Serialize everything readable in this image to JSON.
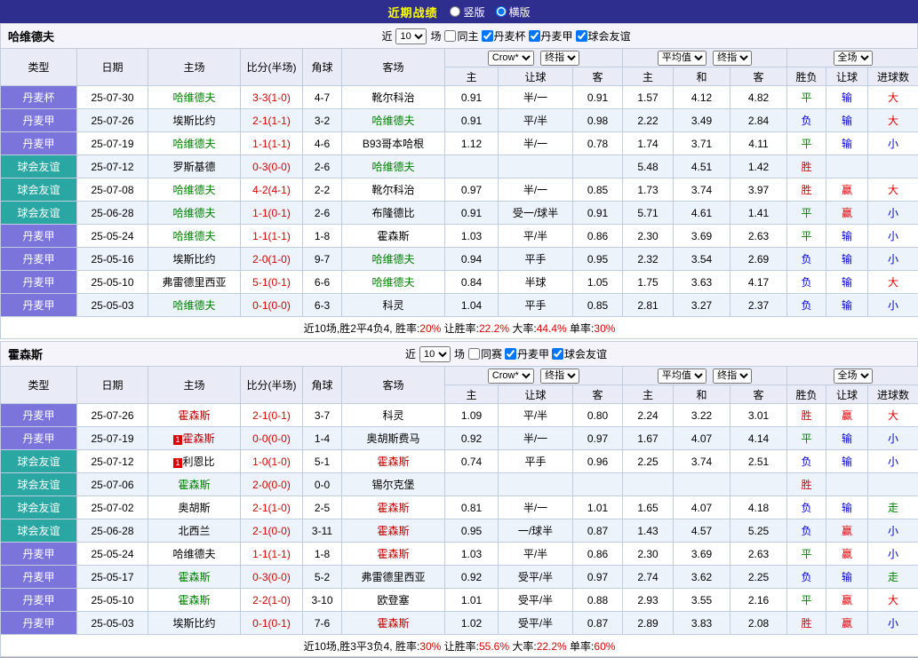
{
  "titlebar": {
    "title": "近期战绩",
    "view_options": [
      {
        "label": "竖版",
        "selected": false
      },
      {
        "label": "横版",
        "selected": true
      }
    ]
  },
  "colors": {
    "topbar_bg": "#2e2e8f",
    "title_text": "#ffff00",
    "cup_bg": "#7b74da",
    "league_bg": "#7b74da",
    "friendly_bg": "#2aa7a2",
    "win_red": "#e10000",
    "draw_green": "#008000",
    "lose_blue": "#0000d9",
    "focus_team_green": "#008000",
    "focus_team_red": "#c00000",
    "score_red": "#d60000"
  },
  "sections": [
    {
      "team": "哈维德夫",
      "filter": {
        "prefix": "近",
        "count": "10",
        "suffix": "场",
        "checkboxes": [
          {
            "label": "同主",
            "checked": false
          },
          {
            "label": "丹麦杯",
            "checked": true
          },
          {
            "label": "丹麦甲",
            "checked": true
          },
          {
            "label": "球会友谊",
            "checked": true
          }
        ]
      },
      "columns": {
        "type": "类型",
        "date": "日期",
        "home": "主场",
        "score": "比分(半场)",
        "corner": "角球",
        "away": "客场",
        "odds_group": {
          "select1": "Crow*",
          "select2": "终指",
          "subs": [
            "主",
            "让球",
            "客"
          ]
        },
        "avg_group": {
          "select1": "平均值",
          "select2": "终指",
          "subs": [
            "主",
            "和",
            "客"
          ]
        },
        "result_group": {
          "select1": "全场",
          "subs": [
            "胜负",
            "让球",
            "进球数"
          ]
        }
      },
      "rows": [
        {
          "type": "丹麦杯",
          "type_cls": "t-cup",
          "date": "25-07-30",
          "home": "哈维德夫",
          "home_cls": "n-green",
          "score": "3-3(1-0)",
          "corner": "4-7",
          "away": "靴尔科治",
          "away_cls": "",
          "odds": [
            "0.91",
            "半/一",
            "0.91"
          ],
          "avg": [
            "1.57",
            "4.12",
            "4.82"
          ],
          "res": [
            {
              "t": "平",
              "c": "g"
            },
            {
              "t": "输",
              "c": "b"
            },
            {
              "t": "大",
              "c": "r"
            }
          ]
        },
        {
          "type": "丹麦甲",
          "type_cls": "t-league",
          "date": "25-07-26",
          "home": "埃斯比约",
          "home_cls": "",
          "score": "2-1(1-1)",
          "corner": "3-2",
          "away": "哈维德夫",
          "away_cls": "n-green",
          "odds": [
            "0.91",
            "平/半",
            "0.98"
          ],
          "avg": [
            "2.22",
            "3.49",
            "2.84"
          ],
          "res": [
            {
              "t": "负",
              "c": "b"
            },
            {
              "t": "输",
              "c": "b"
            },
            {
              "t": "大",
              "c": "r"
            }
          ]
        },
        {
          "type": "丹麦甲",
          "type_cls": "t-league",
          "date": "25-07-19",
          "home": "哈维德夫",
          "home_cls": "n-green",
          "score": "1-1(1-1)",
          "corner": "4-6",
          "away": "B93哥本哈根",
          "away_cls": "",
          "odds": [
            "1.12",
            "半/一",
            "0.78"
          ],
          "avg": [
            "1.74",
            "3.71",
            "4.11"
          ],
          "res": [
            {
              "t": "平",
              "c": "g"
            },
            {
              "t": "输",
              "c": "b"
            },
            {
              "t": "小",
              "c": "b"
            }
          ]
        },
        {
          "type": "球会友谊",
          "type_cls": "t-friendly",
          "date": "25-07-12",
          "home": "罗斯基德",
          "home_cls": "",
          "score": "0-3(0-0)",
          "corner": "2-6",
          "away": "哈维德夫",
          "away_cls": "n-green",
          "odds": [
            "",
            "",
            ""
          ],
          "avg": [
            "5.48",
            "4.51",
            "1.42"
          ],
          "res": [
            {
              "t": "胜",
              "c": "r"
            },
            {
              "t": "",
              "c": "b"
            },
            {
              "t": "",
              "c": "b"
            }
          ]
        },
        {
          "type": "球会友谊",
          "type_cls": "t-friendly",
          "date": "25-07-08",
          "home": "哈维德夫",
          "home_cls": "n-green",
          "score": "4-2(4-1)",
          "corner": "2-2",
          "away": "靴尔科治",
          "away_cls": "",
          "odds": [
            "0.97",
            "半/一",
            "0.85"
          ],
          "avg": [
            "1.73",
            "3.74",
            "3.97"
          ],
          "res": [
            {
              "t": "胜",
              "c": "r"
            },
            {
              "t": "赢",
              "c": "r"
            },
            {
              "t": "大",
              "c": "r"
            }
          ]
        },
        {
          "type": "球会友谊",
          "type_cls": "t-friendly",
          "date": "25-06-28",
          "home": "哈维德夫",
          "home_cls": "n-green",
          "score": "1-1(0-1)",
          "corner": "2-6",
          "away": "布隆德比",
          "away_cls": "",
          "odds": [
            "0.91",
            "受一/球半",
            "0.91"
          ],
          "avg": [
            "5.71",
            "4.61",
            "1.41"
          ],
          "res": [
            {
              "t": "平",
              "c": "g"
            },
            {
              "t": "赢",
              "c": "r"
            },
            {
              "t": "小",
              "c": "b"
            }
          ]
        },
        {
          "type": "丹麦甲",
          "type_cls": "t-league",
          "date": "25-05-24",
          "home": "哈维德夫",
          "home_cls": "n-green",
          "score": "1-1(1-1)",
          "corner": "1-8",
          "away": "霍森斯",
          "away_cls": "",
          "odds": [
            "1.03",
            "平/半",
            "0.86"
          ],
          "avg": [
            "2.30",
            "3.69",
            "2.63"
          ],
          "res": [
            {
              "t": "平",
              "c": "g"
            },
            {
              "t": "输",
              "c": "b"
            },
            {
              "t": "小",
              "c": "b"
            }
          ]
        },
        {
          "type": "丹麦甲",
          "type_cls": "t-league",
          "date": "25-05-16",
          "home": "埃斯比约",
          "home_cls": "",
          "score": "2-0(1-0)",
          "corner": "9-7",
          "away": "哈维德夫",
          "away_cls": "n-green",
          "odds": [
            "0.94",
            "平手",
            "0.95"
          ],
          "avg": [
            "2.32",
            "3.54",
            "2.69"
          ],
          "res": [
            {
              "t": "负",
              "c": "b"
            },
            {
              "t": "输",
              "c": "b"
            },
            {
              "t": "小",
              "c": "b"
            }
          ]
        },
        {
          "type": "丹麦甲",
          "type_cls": "t-league",
          "date": "25-05-10",
          "home": "弗雷德里西亚",
          "home_cls": "",
          "score": "5-1(0-1)",
          "corner": "6-6",
          "away": "哈维德夫",
          "away_cls": "n-green",
          "odds": [
            "0.84",
            "半球",
            "1.05"
          ],
          "avg": [
            "1.75",
            "3.63",
            "4.17"
          ],
          "res": [
            {
              "t": "负",
              "c": "b"
            },
            {
              "t": "输",
              "c": "b"
            },
            {
              "t": "大",
              "c": "r"
            }
          ]
        },
        {
          "type": "丹麦甲",
          "type_cls": "t-league",
          "date": "25-05-03",
          "home": "哈维德夫",
          "home_cls": "n-green",
          "score": "0-1(0-0)",
          "corner": "6-3",
          "away": "科灵",
          "away_cls": "",
          "odds": [
            "1.04",
            "平手",
            "0.85"
          ],
          "avg": [
            "2.81",
            "3.27",
            "2.37"
          ],
          "res": [
            {
              "t": "负",
              "c": "b"
            },
            {
              "t": "输",
              "c": "b"
            },
            {
              "t": "小",
              "c": "b"
            }
          ]
        }
      ],
      "summary": {
        "prefix": "近10场,胜2平4负4,",
        "stats": [
          {
            "label": "胜率:",
            "value": "20%"
          },
          {
            "label": "让胜率:",
            "value": "22.2%"
          },
          {
            "label": "大率:",
            "value": "44.4%"
          },
          {
            "label": "单率:",
            "value": "30%"
          }
        ]
      }
    },
    {
      "team": "霍森斯",
      "filter": {
        "prefix": "近",
        "count": "10",
        "suffix": "场",
        "checkboxes": [
          {
            "label": "同赛",
            "checked": false
          },
          {
            "label": "丹麦甲",
            "checked": true
          },
          {
            "label": "球会友谊",
            "checked": true
          }
        ]
      },
      "columns": {
        "type": "类型",
        "date": "日期",
        "home": "主场",
        "score": "比分(半场)",
        "corner": "角球",
        "away": "客场",
        "odds_group": {
          "select1": "Crow*",
          "select2": "终指",
          "subs": [
            "主",
            "让球",
            "客"
          ]
        },
        "avg_group": {
          "select1": "平均值",
          "select2": "终指",
          "subs": [
            "主",
            "和",
            "客"
          ]
        },
        "result_group": {
          "select1": "全场",
          "subs": [
            "胜负",
            "让球",
            "进球数"
          ]
        }
      },
      "rows": [
        {
          "type": "丹麦甲",
          "type_cls": "t-league",
          "date": "25-07-26",
          "home": "霍森斯",
          "home_cls": "n-red",
          "score": "2-1(0-1)",
          "corner": "3-7",
          "away": "科灵",
          "away_cls": "",
          "odds": [
            "1.09",
            "平/半",
            "0.80"
          ],
          "avg": [
            "2.24",
            "3.22",
            "3.01"
          ],
          "res": [
            {
              "t": "胜",
              "c": "r"
            },
            {
              "t": "赢",
              "c": "r"
            },
            {
              "t": "大",
              "c": "r"
            }
          ]
        },
        {
          "type": "丹麦甲",
          "type_cls": "t-league",
          "date": "25-07-19",
          "home": "霍森斯",
          "home_cls": "n-red",
          "home_badge": "1",
          "score": "0-0(0-0)",
          "corner": "1-4",
          "away": "奥胡斯费马",
          "away_cls": "",
          "odds": [
            "0.92",
            "半/一",
            "0.97"
          ],
          "avg": [
            "1.67",
            "4.07",
            "4.14"
          ],
          "res": [
            {
              "t": "平",
              "c": "g"
            },
            {
              "t": "输",
              "c": "b"
            },
            {
              "t": "小",
              "c": "b"
            }
          ]
        },
        {
          "type": "球会友谊",
          "type_cls": "t-friendly",
          "date": "25-07-12",
          "home": "利恩比",
          "home_cls": "",
          "home_badge": "1",
          "score": "1-0(1-0)",
          "corner": "5-1",
          "away": "霍森斯",
          "away_cls": "n-red",
          "odds": [
            "0.74",
            "平手",
            "0.96"
          ],
          "avg": [
            "2.25",
            "3.74",
            "2.51"
          ],
          "res": [
            {
              "t": "负",
              "c": "b"
            },
            {
              "t": "输",
              "c": "b"
            },
            {
              "t": "小",
              "c": "b"
            }
          ]
        },
        {
          "type": "球会友谊",
          "type_cls": "t-friendly",
          "date": "25-07-06",
          "home": "霍森斯",
          "home_cls": "n-green",
          "score": "2-0(0-0)",
          "corner": "0-0",
          "away": "锡尔克堡",
          "away_cls": "",
          "odds": [
            "",
            "",
            ""
          ],
          "avg": [
            "",
            "",
            ""
          ],
          "res": [
            {
              "t": "胜",
              "c": "r"
            },
            {
              "t": "",
              "c": "b"
            },
            {
              "t": "",
              "c": "b"
            }
          ]
        },
        {
          "type": "球会友谊",
          "type_cls": "t-friendly",
          "date": "25-07-02",
          "home": "奥胡斯",
          "home_cls": "",
          "score": "2-1(1-0)",
          "corner": "2-5",
          "away": "霍森斯",
          "away_cls": "n-red",
          "odds": [
            "0.81",
            "半/一",
            "1.01"
          ],
          "avg": [
            "1.65",
            "4.07",
            "4.18"
          ],
          "res": [
            {
              "t": "负",
              "c": "b"
            },
            {
              "t": "输",
              "c": "b"
            },
            {
              "t": "走",
              "c": "g"
            }
          ]
        },
        {
          "type": "球会友谊",
          "type_cls": "t-friendly",
          "date": "25-06-28",
          "home": "北西兰",
          "home_cls": "",
          "score": "2-1(0-0)",
          "corner": "3-11",
          "away": "霍森斯",
          "away_cls": "n-red",
          "odds": [
            "0.95",
            "一/球半",
            "0.87"
          ],
          "avg": [
            "1.43",
            "4.57",
            "5.25"
          ],
          "res": [
            {
              "t": "负",
              "c": "b"
            },
            {
              "t": "赢",
              "c": "r"
            },
            {
              "t": "小",
              "c": "b"
            }
          ]
        },
        {
          "type": "丹麦甲",
          "type_cls": "t-league",
          "date": "25-05-24",
          "home": "哈维德夫",
          "home_cls": "",
          "score": "1-1(1-1)",
          "corner": "1-8",
          "away": "霍森斯",
          "away_cls": "n-red",
          "odds": [
            "1.03",
            "平/半",
            "0.86"
          ],
          "avg": [
            "2.30",
            "3.69",
            "2.63"
          ],
          "res": [
            {
              "t": "平",
              "c": "g"
            },
            {
              "t": "赢",
              "c": "r"
            },
            {
              "t": "小",
              "c": "b"
            }
          ]
        },
        {
          "type": "丹麦甲",
          "type_cls": "t-league",
          "date": "25-05-17",
          "home": "霍森斯",
          "home_cls": "n-green",
          "score": "0-3(0-0)",
          "corner": "5-2",
          "away": "弗雷德里西亚",
          "away_cls": "",
          "odds": [
            "0.92",
            "受平/半",
            "0.97"
          ],
          "avg": [
            "2.74",
            "3.62",
            "2.25"
          ],
          "res": [
            {
              "t": "负",
              "c": "b"
            },
            {
              "t": "输",
              "c": "b"
            },
            {
              "t": "走",
              "c": "g"
            }
          ]
        },
        {
          "type": "丹麦甲",
          "type_cls": "t-league",
          "date": "25-05-10",
          "home": "霍森斯",
          "home_cls": "n-green",
          "score": "2-2(1-0)",
          "corner": "3-10",
          "away": "欧登塞",
          "away_cls": "",
          "odds": [
            "1.01",
            "受平/半",
            "0.88"
          ],
          "avg": [
            "2.93",
            "3.55",
            "2.16"
          ],
          "res": [
            {
              "t": "平",
              "c": "g"
            },
            {
              "t": "赢",
              "c": "r"
            },
            {
              "t": "大",
              "c": "r"
            }
          ]
        },
        {
          "type": "丹麦甲",
          "type_cls": "t-league",
          "date": "25-05-03",
          "home": "埃斯比约",
          "home_cls": "",
          "score": "0-1(0-1)",
          "corner": "7-6",
          "away": "霍森斯",
          "away_cls": "n-red",
          "odds": [
            "1.02",
            "受平/半",
            "0.87"
          ],
          "avg": [
            "2.89",
            "3.83",
            "2.08"
          ],
          "res": [
            {
              "t": "胜",
              "c": "r"
            },
            {
              "t": "赢",
              "c": "r"
            },
            {
              "t": "小",
              "c": "b"
            }
          ]
        }
      ],
      "summary": {
        "prefix": "近10场,胜3平3负4,",
        "stats": [
          {
            "label": "胜率:",
            "value": "30%"
          },
          {
            "label": "让胜率:",
            "value": "55.6%"
          },
          {
            "label": "大率:",
            "value": "22.2%"
          },
          {
            "label": "单率:",
            "value": "60%"
          }
        ]
      }
    }
  ]
}
